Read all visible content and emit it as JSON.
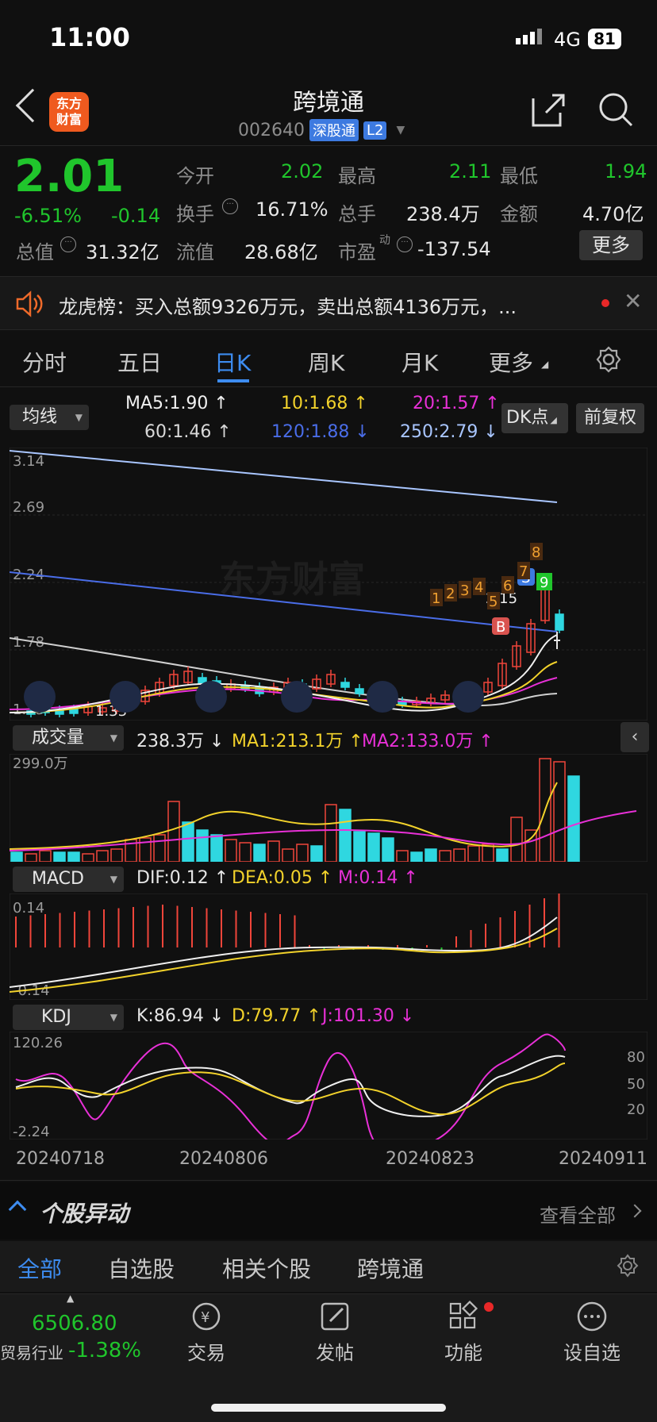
{
  "status": {
    "time": "11:00",
    "network": "4G",
    "battery": "81"
  },
  "header": {
    "title": "跨境通",
    "code": "002640",
    "exchange": "深股通",
    "level": "L2",
    "logo": "东方\n财富"
  },
  "quote": {
    "price": "2.01",
    "change_pct": "-6.51%",
    "change": "-0.14",
    "fields": [
      {
        "label": "今开",
        "value": "2.02",
        "color": "#20c52c"
      },
      {
        "label": "最高",
        "value": "2.11",
        "color": "#20c52c"
      },
      {
        "label": "最低",
        "value": "1.94",
        "color": "#20c52c"
      },
      {
        "label": "换手",
        "value": "16.71%",
        "color": "#e6e6e6"
      },
      {
        "label": "总手",
        "value": "238.4万",
        "color": "#e6e6e6"
      },
      {
        "label": "金额",
        "value": "4.70亿",
        "color": "#e6e6e6"
      },
      {
        "label": "总值",
        "value": "31.32亿",
        "color": "#e6e6e6"
      },
      {
        "label": "流值",
        "value": "28.68亿",
        "color": "#e6e6e6"
      },
      {
        "label": "市盈",
        "sup": "动",
        "value": "-137.54",
        "color": "#e6e6e6"
      }
    ],
    "more": "更多"
  },
  "notice": {
    "text": "龙虎榜：买入总额9326万元，卖出总额4136万元，..."
  },
  "tabs": [
    "分时",
    "五日",
    "日K",
    "周K",
    "月K",
    "更多"
  ],
  "active_tab": "日K",
  "ma": {
    "selector": "均线",
    "ma5": "MA5:1.90 ↑",
    "ma10": "10:1.68 ↑",
    "ma20": "20:1.57 ↑",
    "ma60": "60:1.46 ↑",
    "ma120": "120:1.88 ↓",
    "ma250": "250:2.79 ↓",
    "dk": "DK点",
    "fq": "前复权",
    "colors": {
      "ma5": "#f0f0f0",
      "ma10": "#f2d22b",
      "ma20": "#e830d7",
      "ma60": "#d8d8d8",
      "ma120": "#4a6de8",
      "ma250": "#a9c6ff"
    }
  },
  "kline": {
    "watermark": "东方财富",
    "y_labels": [
      "3.14",
      "2.69",
      "2.24",
      "1.78",
      "1.33"
    ],
    "low_label": "1.33",
    "high_label": "2.15",
    "signals": {
      "b": "B",
      "s": "S",
      "nine": "9",
      "counts": [
        "1",
        "2",
        "3",
        "4",
        "5",
        "6",
        "7",
        "8"
      ]
    }
  },
  "volume": {
    "selector": "成交量",
    "vol": "238.3万 ↓",
    "ma1": "MA1:213.1万 ↑",
    "ma2": "MA2:133.0万 ↑",
    "max_label": "299.0万"
  },
  "macd": {
    "selector": "MACD",
    "dif": "DIF:0.12 ↑",
    "dea": "DEA:0.05 ↑",
    "m": "M:0.14 ↑",
    "top": "0.14",
    "bottom": "-0.14"
  },
  "kdj": {
    "selector": "KDJ",
    "k": "K:86.94 ↓",
    "d": "D:79.77 ↑",
    "j": "J:101.30 ↓",
    "top": "120.26",
    "bottom": "-2.24",
    "levels": [
      "80",
      "50",
      "20"
    ]
  },
  "dates": [
    "20240718",
    "20240806",
    "20240823",
    "20240911"
  ],
  "chart_data": [
    {
      "type": "line",
      "title": "均线",
      "series": [
        {
          "name": "MA5",
          "last": 1.9
        },
        {
          "name": "MA10",
          "last": 1.68
        },
        {
          "name": "MA20",
          "last": 1.57
        },
        {
          "name": "MA60",
          "last": 1.46
        },
        {
          "name": "MA120",
          "last": 1.88
        },
        {
          "name": "MA250",
          "last": 2.79
        }
      ],
      "ylim": [
        1.33,
        3.14
      ],
      "x": [
        "20240718",
        "20240806",
        "20240823",
        "20240911"
      ]
    },
    {
      "type": "bar",
      "title": "成交量",
      "series": [
        {
          "name": "VOL",
          "last": "238.3万"
        },
        {
          "name": "MA1",
          "last": "213.1万"
        },
        {
          "name": "MA2",
          "last": "133.0万"
        }
      ],
      "ymax": "299.0万"
    },
    {
      "type": "line",
      "title": "MACD",
      "series": [
        {
          "name": "DIF",
          "last": 0.12
        },
        {
          "name": "DEA",
          "last": 0.05
        },
        {
          "name": "M",
          "last": 0.14
        }
      ],
      "ylim": [
        -0.14,
        0.14
      ]
    },
    {
      "type": "line",
      "title": "KDJ",
      "series": [
        {
          "name": "K",
          "last": 86.94
        },
        {
          "name": "D",
          "last": 79.77
        },
        {
          "name": "J",
          "last": 101.3
        }
      ],
      "ylim": [
        -2.24,
        120.26
      ]
    }
  ],
  "movers": {
    "title": "个股异动",
    "view_all": "查看全部"
  },
  "sub_tabs": [
    "全部",
    "自选股",
    "相关个股",
    "跨境通"
  ],
  "bottom_nav": {
    "index_value": "6506.80",
    "index_name": "贸易行业",
    "index_change": "-1.38%",
    "items": [
      {
        "label": "交易",
        "icon": "trade-icon"
      },
      {
        "label": "发帖",
        "icon": "post-icon"
      },
      {
        "label": "功能",
        "icon": "function-icon"
      },
      {
        "label": "设自选",
        "icon": "add-watchlist-icon"
      }
    ]
  }
}
